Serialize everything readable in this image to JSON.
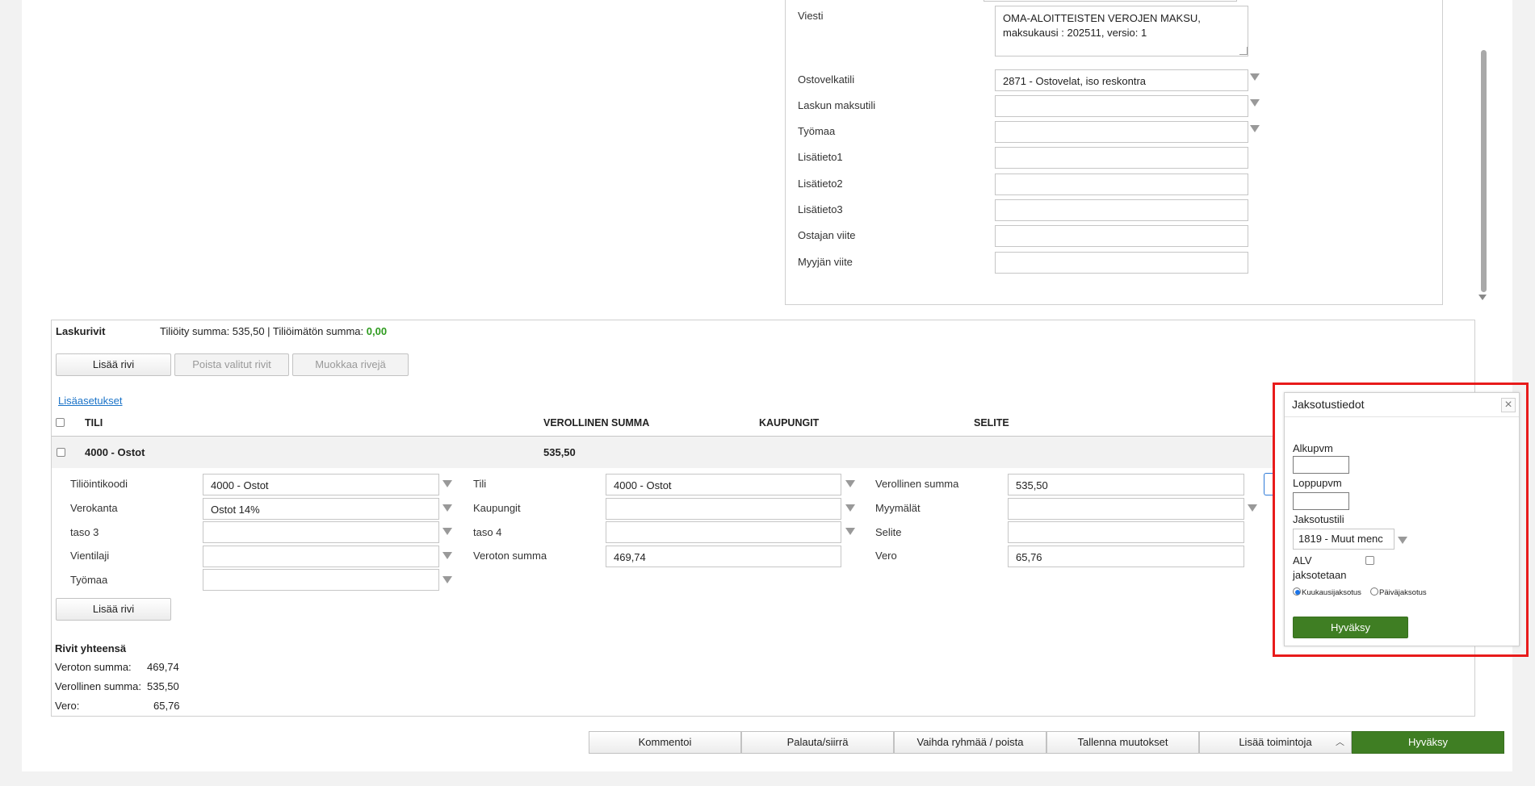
{
  "header_form": {
    "viesti_label": "Viesti",
    "viesti_value": "OMA-ALOITTEISTEN VEROJEN MAKSU, maksukausi : 202511, versio: 1",
    "fields": [
      {
        "label": "Ostovelkatili",
        "value": "2871 - Ostovelat, iso reskontra",
        "dropdown": true
      },
      {
        "label": "Laskun maksutili",
        "value": "",
        "dropdown": true
      },
      {
        "label": "Työmaa",
        "value": "",
        "dropdown": true
      },
      {
        "label": "Lisätieto1",
        "value": "",
        "dropdown": false
      },
      {
        "label": "Lisätieto2",
        "value": "",
        "dropdown": false
      },
      {
        "label": "Lisätieto3",
        "value": "",
        "dropdown": false
      },
      {
        "label": "Ostajan viite",
        "value": "",
        "dropdown": false
      },
      {
        "label": "Myyjän viite",
        "value": "",
        "dropdown": false
      }
    ]
  },
  "laskurivit": {
    "title": "Laskurivit",
    "summary_prefix": "Tiliöity summa: 535,50 | Tiliöimätön summa: ",
    "summary_unposted": "0,00",
    "buttons": {
      "add": "Lisää rivi",
      "delete": "Poista valitut rivit",
      "edit": "Muokkaa rivejä"
    },
    "more_settings": "Lisäasetukset",
    "columns": {
      "tili": "TILI",
      "verollinen": "VEROLLINEN SUMMA",
      "kaupungit": "KAUPUNGIT",
      "selite": "SELITE"
    },
    "row": {
      "tili": "4000 - Ostot",
      "verollinen": "535,50"
    },
    "detail": {
      "col1": [
        {
          "label": "Tiliöintikoodi",
          "value": "4000 - Ostot"
        },
        {
          "label": "Verokanta",
          "value": "Ostot 14%"
        },
        {
          "label": "taso 3",
          "value": ""
        },
        {
          "label": "Vientilaji",
          "value": ""
        },
        {
          "label": "Työmaa",
          "value": ""
        }
      ],
      "col2": [
        {
          "label": "Tili",
          "value": "4000 - Ostot"
        },
        {
          "label": "Kaupungit",
          "value": ""
        },
        {
          "label": "taso 4",
          "value": ""
        },
        {
          "label": "Veroton summa",
          "value": "469,74"
        }
      ],
      "col3": [
        {
          "label": "Verollinen summa",
          "value": "535,50"
        },
        {
          "label": "Myymälät",
          "value": ""
        },
        {
          "label": "Selite",
          "value": ""
        },
        {
          "label": "Vero",
          "value": "65,76"
        }
      ]
    },
    "add_row_bottom": "Lisää rivi",
    "totals": {
      "title": "Rivit yhteensä",
      "rows": [
        {
          "label": "Veroton summa:",
          "value": "469,74"
        },
        {
          "label": "Verollinen summa:",
          "value": "535,50"
        },
        {
          "label": "Vero:",
          "value": "65,76"
        }
      ]
    }
  },
  "bottom_bar": {
    "kommentoi": "Kommentoi",
    "palauta": "Palauta/siirrä",
    "vaihda": "Vaihda ryhmää / poista",
    "tallenna": "Tallenna muutokset",
    "lisaa_toimintoja": "Lisää toimintoja",
    "hyvaksy": "Hyväksy"
  },
  "popup": {
    "title": "Jaksotustiedot",
    "close": "×",
    "alkupvm_label": "Alkupvm",
    "alkupvm_value": "",
    "loppupvm_label": "Loppupvm",
    "loppupvm_value": "",
    "jaksotustili_label": "Jaksotustili",
    "jaksotustili_value": "1819 - Muut menc",
    "alv_label_1": "ALV",
    "alv_label_2": "jaksotetaan",
    "radio_month": "Kuukausijaksotus",
    "radio_day": "Päiväjaksotus",
    "selected_radio": "Kuukausijaksotus",
    "approve": "Hyväksy"
  },
  "colors": {
    "accent_green": "#3f7e23",
    "highlight_red": "#e81b1b",
    "link_blue": "#1a73c8"
  }
}
